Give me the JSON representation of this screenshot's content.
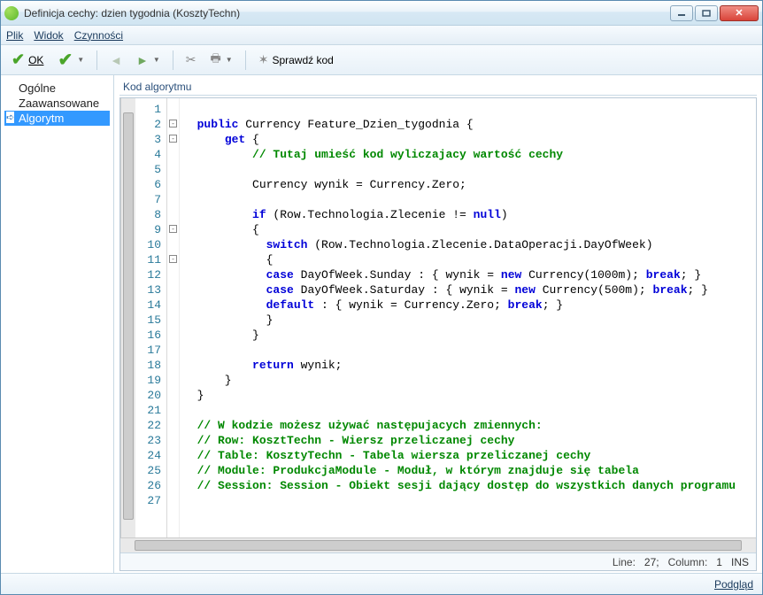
{
  "window": {
    "title": "Definicja cechy: dzien tygodnia (KosztyTechn)"
  },
  "menu": {
    "file": "Plik",
    "view": "Widok",
    "actions": "Czynności"
  },
  "toolbar": {
    "ok": "OK",
    "check_code": "Sprawdź kod"
  },
  "sidebar": {
    "items": [
      {
        "label": "Ogólne"
      },
      {
        "label": "Zaawansowane"
      },
      {
        "label": "Algorytm"
      }
    ]
  },
  "editor": {
    "label": "Kod algorytmu",
    "status": {
      "line_label": "Line:",
      "line": "27;",
      "col_label": "Column:",
      "col": "1",
      "mode": "INS"
    },
    "code_lines": [
      {
        "n": 1,
        "fold": "",
        "tokens": [
          {
            "t": "",
            "c": ""
          }
        ]
      },
      {
        "n": 2,
        "fold": "box",
        "tokens": [
          {
            "t": "  ",
            "c": ""
          },
          {
            "t": "public",
            "c": "kw"
          },
          {
            "t": " Currency Feature_Dzien_tygodnia {",
            "c": ""
          }
        ]
      },
      {
        "n": 3,
        "fold": "box",
        "tokens": [
          {
            "t": "      ",
            "c": ""
          },
          {
            "t": "get",
            "c": "kw"
          },
          {
            "t": " {",
            "c": ""
          }
        ]
      },
      {
        "n": 4,
        "fold": "",
        "tokens": [
          {
            "t": "          ",
            "c": ""
          },
          {
            "t": "// Tutaj umieść kod wyliczajacy wartość cechy",
            "c": "cm"
          }
        ]
      },
      {
        "n": 5,
        "fold": "",
        "tokens": [
          {
            "t": "",
            "c": ""
          }
        ]
      },
      {
        "n": 6,
        "fold": "",
        "tokens": [
          {
            "t": "          Currency wynik = Currency.Zero;",
            "c": ""
          }
        ]
      },
      {
        "n": 7,
        "fold": "",
        "tokens": [
          {
            "t": "",
            "c": ""
          }
        ]
      },
      {
        "n": 8,
        "fold": "",
        "tokens": [
          {
            "t": "          ",
            "c": ""
          },
          {
            "t": "if",
            "c": "kw"
          },
          {
            "t": " (Row.Technologia.Zlecenie != ",
            "c": ""
          },
          {
            "t": "null",
            "c": "kw"
          },
          {
            "t": ")",
            "c": ""
          }
        ]
      },
      {
        "n": 9,
        "fold": "box",
        "tokens": [
          {
            "t": "          {",
            "c": ""
          }
        ]
      },
      {
        "n": 10,
        "fold": "",
        "tokens": [
          {
            "t": "            ",
            "c": ""
          },
          {
            "t": "switch",
            "c": "kw"
          },
          {
            "t": " (Row.Technologia.Zlecenie.DataOperacji.DayOfWeek)",
            "c": ""
          }
        ]
      },
      {
        "n": 11,
        "fold": "box",
        "tokens": [
          {
            "t": "            {",
            "c": ""
          }
        ]
      },
      {
        "n": 12,
        "fold": "",
        "tokens": [
          {
            "t": "            ",
            "c": ""
          },
          {
            "t": "case",
            "c": "kw"
          },
          {
            "t": " DayOfWeek.Sunday : { wynik = ",
            "c": ""
          },
          {
            "t": "new",
            "c": "kw"
          },
          {
            "t": " Currency(1000m); ",
            "c": ""
          },
          {
            "t": "break",
            "c": "kw"
          },
          {
            "t": "; }",
            "c": ""
          }
        ]
      },
      {
        "n": 13,
        "fold": "",
        "tokens": [
          {
            "t": "            ",
            "c": ""
          },
          {
            "t": "case",
            "c": "kw"
          },
          {
            "t": " DayOfWeek.Saturday : { wynik = ",
            "c": ""
          },
          {
            "t": "new",
            "c": "kw"
          },
          {
            "t": " Currency(500m); ",
            "c": ""
          },
          {
            "t": "break",
            "c": "kw"
          },
          {
            "t": "; }",
            "c": ""
          }
        ]
      },
      {
        "n": 14,
        "fold": "",
        "tokens": [
          {
            "t": "            ",
            "c": ""
          },
          {
            "t": "default",
            "c": "kw"
          },
          {
            "t": " : { wynik = Currency.Zero; ",
            "c": ""
          },
          {
            "t": "break",
            "c": "kw"
          },
          {
            "t": "; }",
            "c": ""
          }
        ]
      },
      {
        "n": 15,
        "fold": "",
        "tokens": [
          {
            "t": "            }",
            "c": ""
          }
        ]
      },
      {
        "n": 16,
        "fold": "",
        "tokens": [
          {
            "t": "          }",
            "c": ""
          }
        ]
      },
      {
        "n": 17,
        "fold": "",
        "tokens": [
          {
            "t": "",
            "c": ""
          }
        ]
      },
      {
        "n": 18,
        "fold": "",
        "tokens": [
          {
            "t": "          ",
            "c": ""
          },
          {
            "t": "return",
            "c": "kw"
          },
          {
            "t": " wynik;",
            "c": ""
          }
        ]
      },
      {
        "n": 19,
        "fold": "",
        "tokens": [
          {
            "t": "      }",
            "c": ""
          }
        ]
      },
      {
        "n": 20,
        "fold": "",
        "tokens": [
          {
            "t": "  }",
            "c": ""
          }
        ]
      },
      {
        "n": 21,
        "fold": "",
        "tokens": [
          {
            "t": "",
            "c": ""
          }
        ]
      },
      {
        "n": 22,
        "fold": "",
        "tokens": [
          {
            "t": "  ",
            "c": ""
          },
          {
            "t": "// W kodzie możesz używać następujacych zmiennych:",
            "c": "cm"
          }
        ]
      },
      {
        "n": 23,
        "fold": "",
        "tokens": [
          {
            "t": "  ",
            "c": ""
          },
          {
            "t": "// Row: KosztTechn - Wiersz przeliczanej cechy",
            "c": "cm"
          }
        ]
      },
      {
        "n": 24,
        "fold": "",
        "tokens": [
          {
            "t": "  ",
            "c": ""
          },
          {
            "t": "// Table: KosztyTechn - Tabela wiersza przeliczanej cechy",
            "c": "cm"
          }
        ]
      },
      {
        "n": 25,
        "fold": "",
        "tokens": [
          {
            "t": "  ",
            "c": ""
          },
          {
            "t": "// Module: ProdukcjaModule - Moduł, w którym znajduje się tabela",
            "c": "cm"
          }
        ]
      },
      {
        "n": 26,
        "fold": "",
        "tokens": [
          {
            "t": "  ",
            "c": ""
          },
          {
            "t": "// Session: Session - Obiekt sesji dający dostęp do wszystkich danych programu",
            "c": "cm"
          }
        ]
      },
      {
        "n": 27,
        "fold": "",
        "tokens": [
          {
            "t": "",
            "c": ""
          }
        ]
      }
    ]
  },
  "bottom": {
    "preview": "Podgląd"
  }
}
